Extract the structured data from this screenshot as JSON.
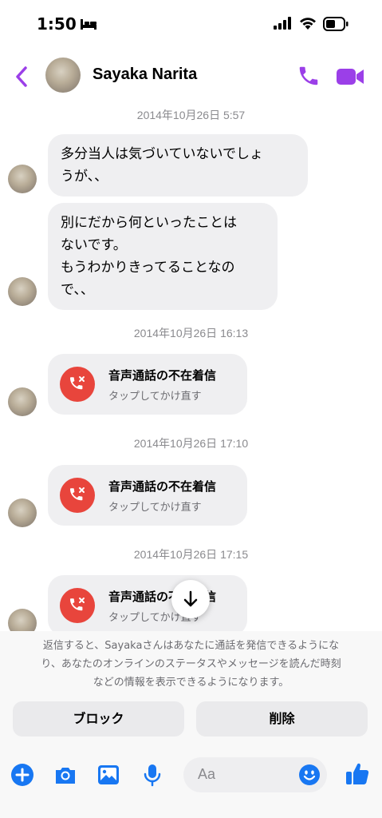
{
  "status_bar": {
    "time": "1:50"
  },
  "header": {
    "contact_name": "Sayaka Narita"
  },
  "messages": [
    {
      "type": "timestamp",
      "text": "2014年10月26日 5:57"
    },
    {
      "type": "text",
      "lines": [
        "多分当人は気づいていないでしょ",
        "うが、、"
      ]
    },
    {
      "type": "text",
      "lines": [
        "別にだから何といったことは",
        "ないです。",
        "もうわかりきってることなの",
        "で、、"
      ]
    },
    {
      "type": "timestamp",
      "text": "2014年10月26日 16:13"
    },
    {
      "type": "missed_call",
      "title": "音声通話の不在着信",
      "subtitle": "タップしてかけ直す"
    },
    {
      "type": "timestamp",
      "text": "2014年10月26日 17:10"
    },
    {
      "type": "missed_call",
      "title": "音声通話の不在着信",
      "subtitle": "タップしてかけ直す"
    },
    {
      "type": "timestamp",
      "text": "2014年10月26日 17:15"
    },
    {
      "type": "missed_call",
      "title": "音声通話の不在着信",
      "subtitle": "タップしてかけ直す"
    }
  ],
  "notice": {
    "lines": [
      "返信すると、Sayakaさんはあなたに通話を発信できるようにな",
      "り、あなたのオンラインのステータスやメッセージを読んだ時刻",
      "などの情報を表示できるようになります。"
    ]
  },
  "actions": {
    "block_label": "ブロック",
    "delete_label": "削除"
  },
  "composer": {
    "placeholder": "Aa"
  },
  "icons": {
    "back": "chevron-left-icon",
    "phone": "phone-icon",
    "video": "video-camera-icon",
    "missed_call": "missed-call-icon",
    "scroll_down": "arrow-down-icon",
    "plus": "plus-icon",
    "camera": "camera-icon",
    "gallery": "image-icon",
    "mic": "microphone-icon",
    "emoji": "emoji-icon",
    "like": "thumbs-up-icon"
  },
  "colors": {
    "accent_purple": "#9b3fe8",
    "accent_blue": "#1877f2",
    "missed_red": "#e8453c",
    "bubble_gray": "#efeff1"
  }
}
